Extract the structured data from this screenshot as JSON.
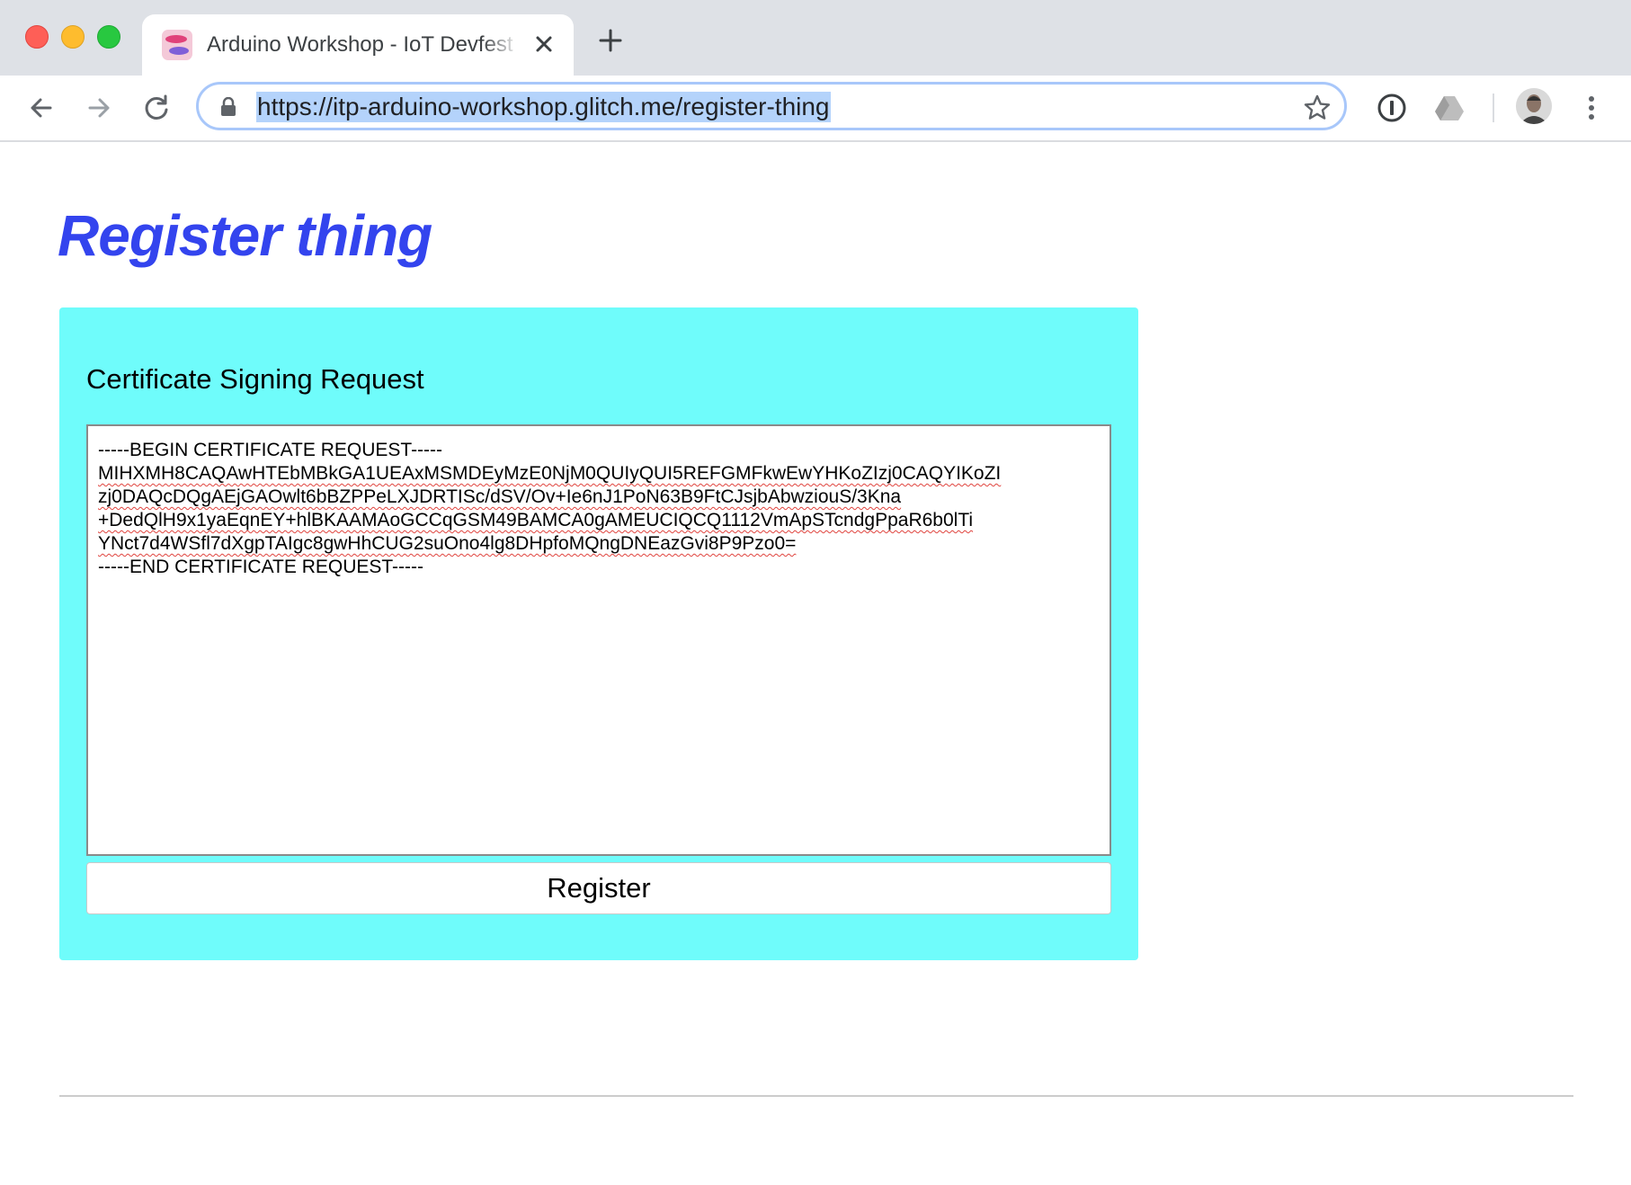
{
  "browser": {
    "tab": {
      "title": "Arduino Workshop - IoT Devfest",
      "favicon": "glitch-fish-icon"
    },
    "url": "https://itp-arduino-workshop.glitch.me/register-thing",
    "icons": {
      "back": "back-arrow-icon",
      "forward": "forward-arrow-icon",
      "reload": "reload-icon",
      "lock": "lock-icon",
      "bookmark": "star-icon",
      "extension_1": "1password-icon",
      "extension_2": "google-drive-icon",
      "menu": "kebab-menu-icon"
    },
    "omnibox_accent": "#a8c7fa",
    "selection_highlight": "#b4d3fb"
  },
  "page": {
    "title": "Register thing",
    "title_color": "#3344ee",
    "panel_color": "#6ffcfb",
    "form": {
      "label": "Certificate Signing Request",
      "csr_lines": [
        "-----BEGIN CERTIFICATE REQUEST-----",
        "MIHXMH8CAQAwHTEbMBkGA1UEAxMSMDEyMzE0NjM0QUIyQUI5REFGMFkwEwYHKoZIzj0CAQYIKoZI",
        "zj0DAQcDQgAEjGAOwlt6bBZPPeLXJDRTISc/dSV/Ov+Ie6nJ1PoN63B9FtCJsjbAbwziouS/3Kna",
        "+DedQlH9x1yaEqnEY+hlBKAAMAoGCCqGSM49BAMCA0gAMEUCIQCQ1112VmApSTcndgPpaR6b0lTi",
        "YNct7d4WSfl7dXgpTAIgc8gwHhCUG2suOno4lg8DHpfoMQngDNEazGvi8P9Pzo0=",
        "-----END CERTIFICATE REQUEST-----"
      ],
      "submit_label": "Register"
    }
  }
}
